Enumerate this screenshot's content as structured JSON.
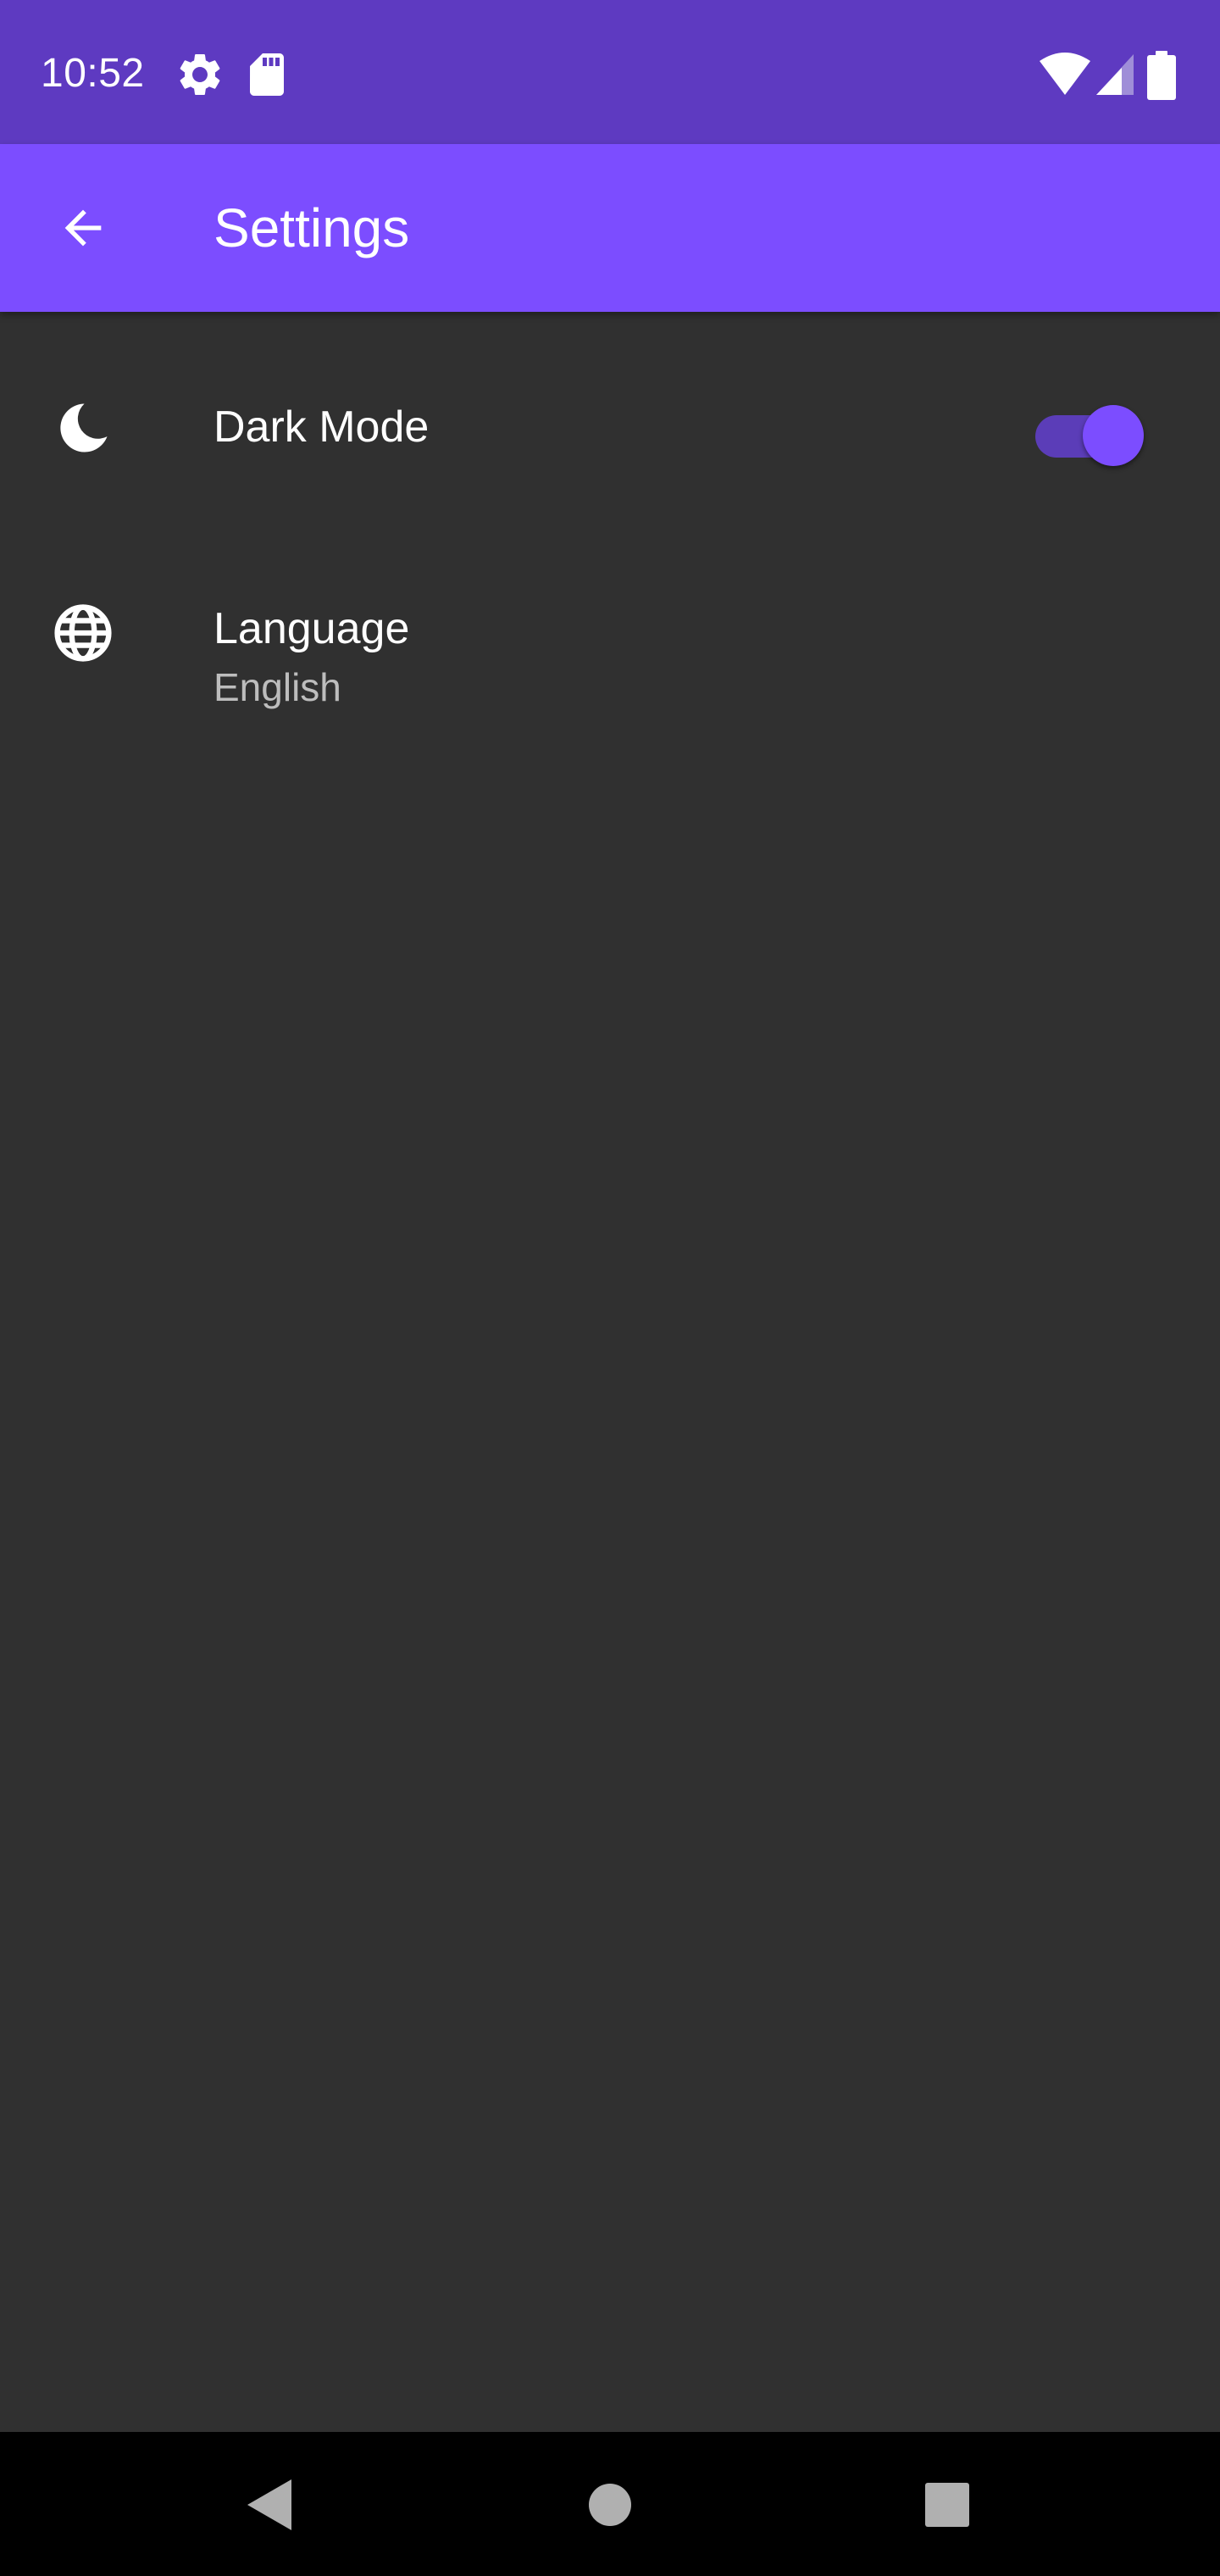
{
  "status_bar": {
    "time": "10:52",
    "icons": [
      "gear-icon",
      "sd-card-icon",
      "wifi-icon",
      "signal-icon",
      "battery-icon"
    ],
    "color": "#5E3AC1"
  },
  "app_bar": {
    "title": "Settings",
    "back_icon": "arrow-back-icon",
    "color": "#7C4DFF"
  },
  "settings": {
    "items": [
      {
        "icon": "moon-icon",
        "title": "Dark Mode",
        "control": "switch",
        "enabled": true
      },
      {
        "icon": "globe-icon",
        "title": "Language",
        "subtitle": "English"
      }
    ]
  },
  "nav_bar": {
    "buttons": [
      "nav-back-icon",
      "nav-home-icon",
      "nav-recents-icon"
    ]
  },
  "colors": {
    "background": "#303030",
    "accent": "#7C4DFF",
    "switch_track": "#5B3DB8",
    "secondary_text": "#BDBDBD"
  }
}
